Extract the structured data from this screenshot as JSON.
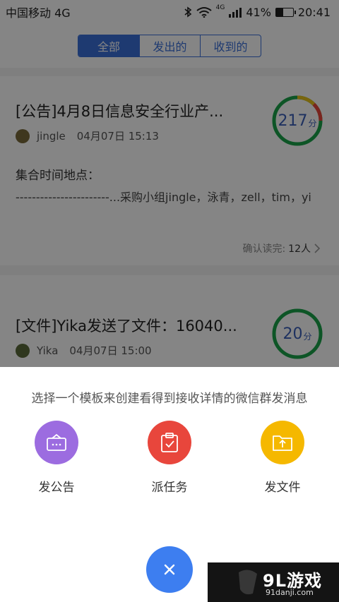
{
  "status_bar": {
    "carrier": "中国移动 4G",
    "network_badge": "4G",
    "battery": "41%",
    "battery_level": 0.41,
    "time": "20:41"
  },
  "tabs": [
    {
      "label": "全部",
      "active": true
    },
    {
      "label": "发出的",
      "active": false
    },
    {
      "label": "收到的",
      "active": false
    }
  ],
  "cards": [
    {
      "title": "[公告]4月8日信息安全行业产...",
      "author": "jingle",
      "time": "04月07日 15:13",
      "body_title": "集合时间地点：",
      "body_text": "-----------------------...采购小组jingle，泳青，zell，tim，yi",
      "read_label": "确认读完:",
      "read_count": "12人",
      "score": "217",
      "score_unit": "分"
    },
    {
      "title": "[文件]Yika发送了文件：16040...",
      "author": "Yika",
      "time": "04月07日 15:00",
      "score": "20",
      "score_unit": "分"
    }
  ],
  "sheet": {
    "prompt": "选择一个模板来创建看得到接收详情的微信群发消息",
    "options": [
      {
        "label": "发公告",
        "icon": "announcement-icon",
        "color": "#9c6ce0"
      },
      {
        "label": "派任务",
        "icon": "task-clipboard-icon",
        "color": "#e8463c"
      },
      {
        "label": "发文件",
        "icon": "file-folder-icon",
        "color": "#f5b800"
      }
    ],
    "close_icon": "close-icon",
    "close_color": "#3d7ef0"
  },
  "watermark": {
    "brand": "9L游戏",
    "url": "91danji.com"
  }
}
